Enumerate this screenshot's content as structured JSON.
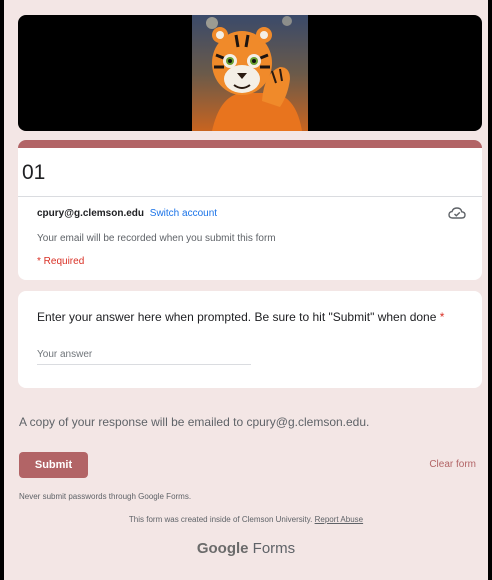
{
  "header": {
    "banner_image": "tiger mascot photo"
  },
  "form": {
    "title": "01",
    "account_email": "cpury@g.clemson.edu",
    "switch_account": "Switch account",
    "cloud_icon": "cloud-check-icon",
    "email_recorded_note": "Your email will be recorded when you submit this form",
    "required_note": "* Required"
  },
  "question": {
    "text": "Enter your answer here when prompted. Be sure to hit \"Submit\" when done",
    "required_marker": "*",
    "answer_placeholder": "Your answer",
    "answer_value": ""
  },
  "footer": {
    "copy_note": "A copy of your response will be emailed to cpury@g.clemson.edu.",
    "submit_label": "Submit",
    "clear_label": "Clear form",
    "password_warning": "Never submit passwords through Google Forms.",
    "created_text": "This form was created inside of Clemson University.",
    "report_abuse": "Report Abuse",
    "brand_google": "Google",
    "brand_forms": "Forms"
  },
  "colors": {
    "accent": "#b26466",
    "background": "#f3e6e5",
    "required": "#d93025",
    "link": "#1a73e8"
  }
}
